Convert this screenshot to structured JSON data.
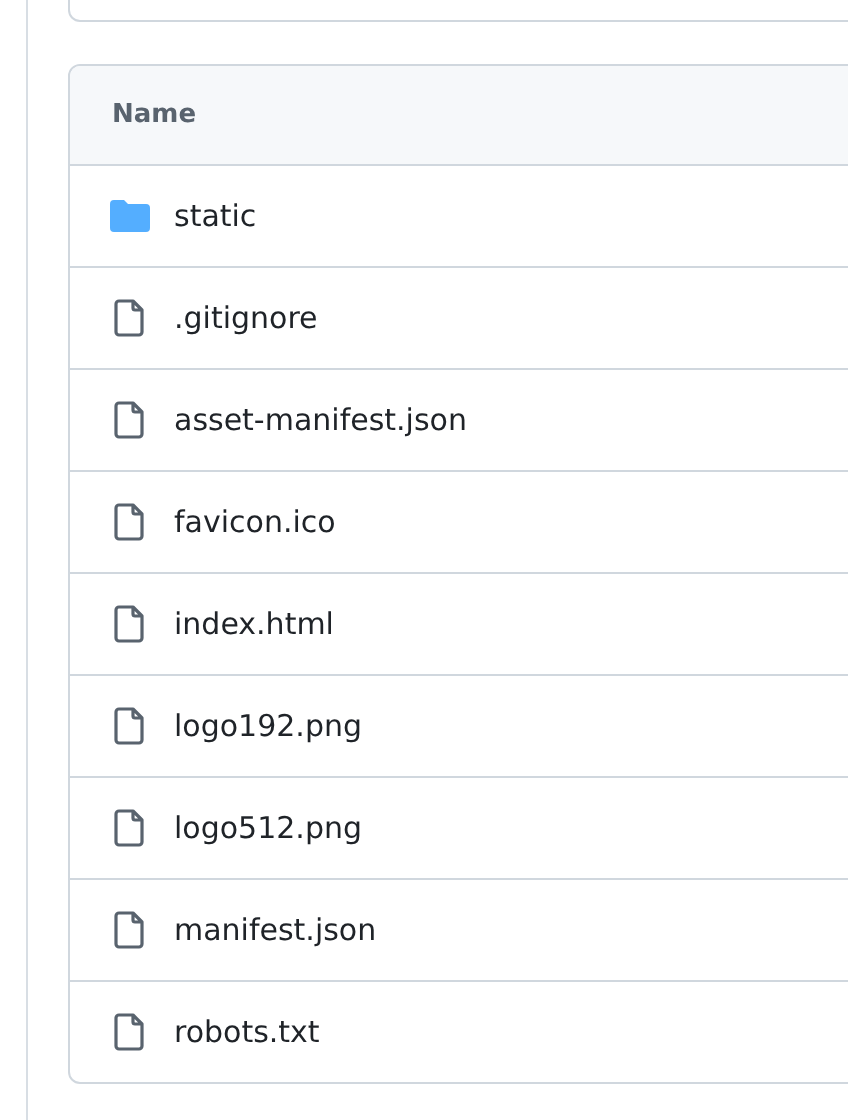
{
  "table": {
    "columns": [
      "Name"
    ],
    "rows": [
      {
        "kind": "folder",
        "name": "static"
      },
      {
        "kind": "file",
        "name": ".gitignore"
      },
      {
        "kind": "file",
        "name": "asset-manifest.json"
      },
      {
        "kind": "file",
        "name": "favicon.ico"
      },
      {
        "kind": "file",
        "name": "index.html"
      },
      {
        "kind": "file",
        "name": "logo192.png"
      },
      {
        "kind": "file",
        "name": "logo512.png"
      },
      {
        "kind": "file",
        "name": "manifest.json"
      },
      {
        "kind": "file",
        "name": "robots.txt"
      }
    ]
  }
}
